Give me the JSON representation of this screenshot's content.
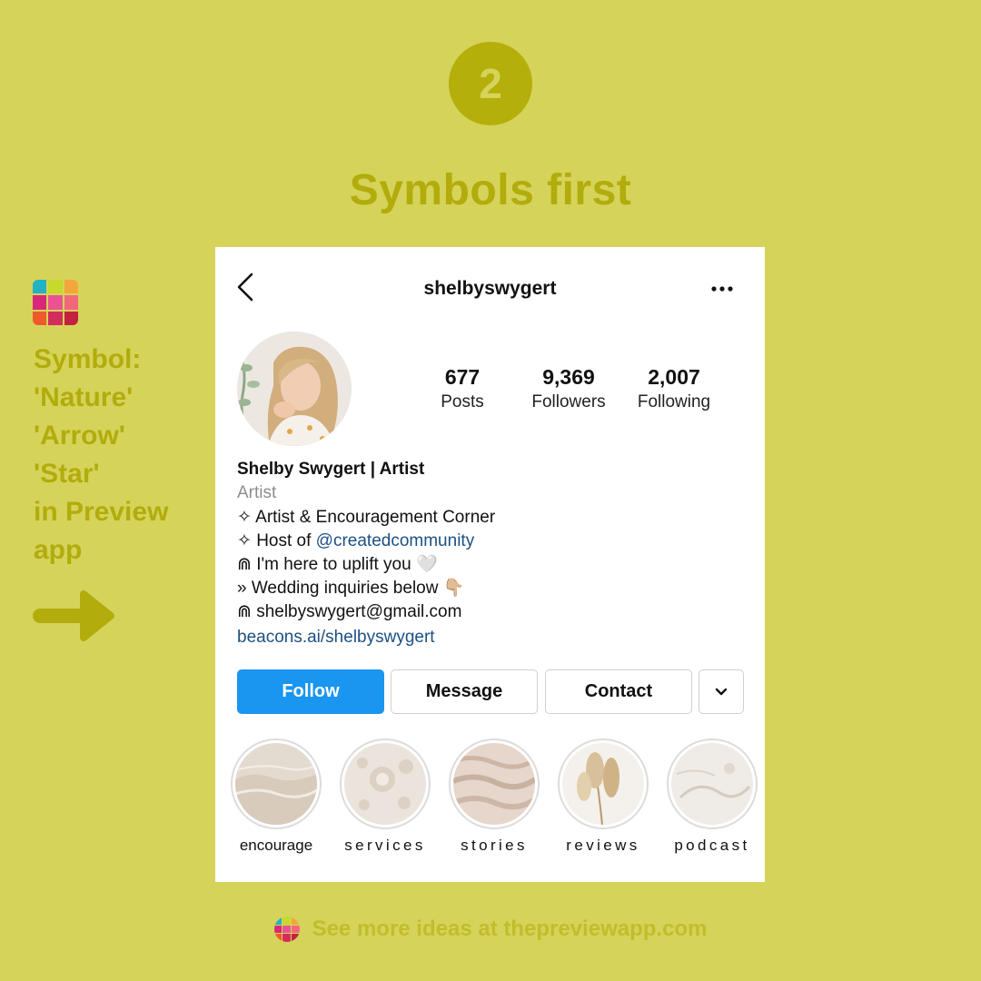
{
  "step": {
    "number": "2"
  },
  "headline": "Symbols first",
  "sidebar": {
    "lines": [
      "Symbol:",
      "'Nature'",
      "'Arrow'",
      "'Star'",
      "in Preview",
      "app"
    ]
  },
  "profile": {
    "username": "shelbyswygert",
    "stats": [
      {
        "value": "677",
        "label": "Posts"
      },
      {
        "value": "9,369",
        "label": "Followers"
      },
      {
        "value": "2,007",
        "label": "Following"
      }
    ],
    "bio": {
      "name": "Shelby Swygert | Artist",
      "category": "Artist",
      "line1": "✧ Artist & Encouragement Corner",
      "line2_prefix": "✧ Host of ",
      "line2_mention": "@createdcommunity",
      "line3": "⋒ I'm here to uplift you 🤍",
      "line4": "» Wedding inquiries below 👇🏼",
      "line5": "⋒ shelbyswygert@gmail.com",
      "link": "beacons.ai/shelbyswygert"
    },
    "buttons": {
      "follow": "Follow",
      "message": "Message",
      "contact": "Contact"
    },
    "highlights": [
      {
        "label": "encourage"
      },
      {
        "label": "services"
      },
      {
        "label": "stories"
      },
      {
        "label": "reviews"
      },
      {
        "label": "podcast"
      }
    ]
  },
  "footer": {
    "text": "See more ideas at thepreviewapp.com"
  },
  "colors": {
    "background": "#d6d35a",
    "accent_olive": "#b2ac0c",
    "follow_blue": "#1a95f0",
    "link_blue": "#1d5083"
  }
}
